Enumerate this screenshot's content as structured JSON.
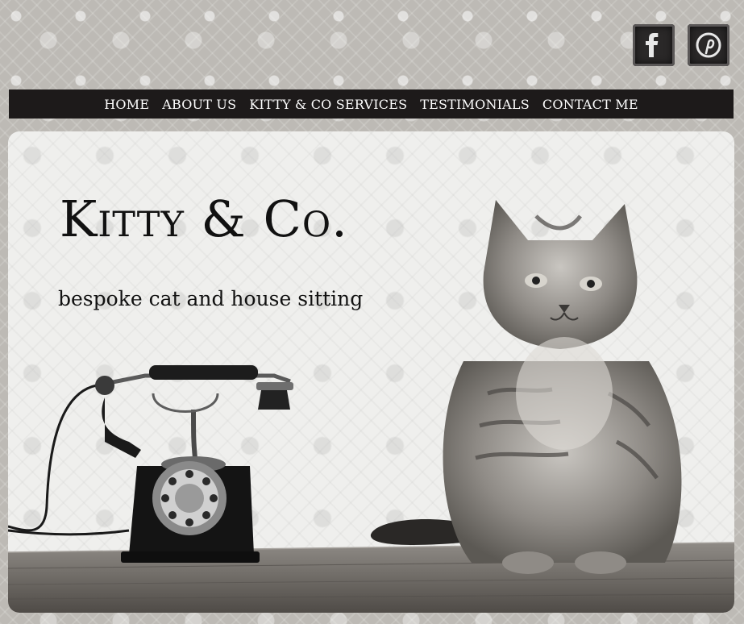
{
  "nav": {
    "items": [
      {
        "label": "HOME"
      },
      {
        "label": "ABOUT US"
      },
      {
        "label": "KITTY & CO SERVICES"
      },
      {
        "label": "TESTIMONIALS"
      },
      {
        "label": "CONTACT ME"
      }
    ]
  },
  "social": {
    "facebook_icon": "facebook-icon",
    "pinterest_icon": "pinterest-icon"
  },
  "hero": {
    "title": "Kitty & Co.",
    "tagline": "bespoke cat and house sitting"
  },
  "colors": {
    "nav_background": "#1d1a1a",
    "nav_text": "#ffffff",
    "page_background": "#bdbab5",
    "hero_background": "#efefed"
  }
}
